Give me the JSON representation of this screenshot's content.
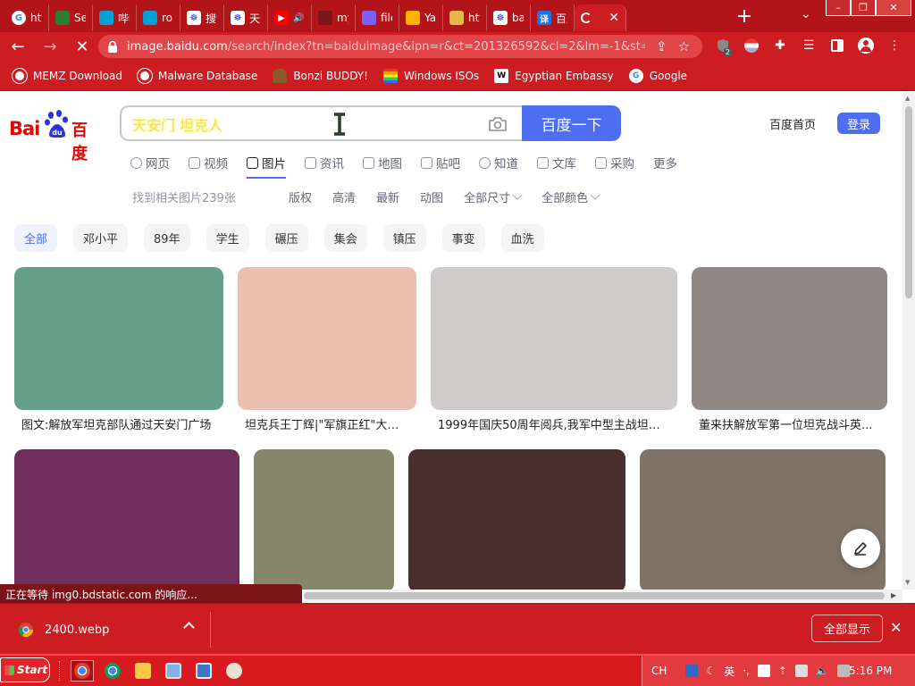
{
  "browser": {
    "tabs": [
      {
        "label": "http",
        "favicon": "google-icon",
        "color": "#4285f4"
      },
      {
        "label": "Sec",
        "favicon": "shield-icon",
        "color": "#2e7d32"
      },
      {
        "label": "哔哩",
        "favicon": "bilibili-icon",
        "color": "#00a1d6"
      },
      {
        "label": "rob",
        "favicon": "bilibili-icon",
        "color": "#00a1d6"
      },
      {
        "label": "搜索",
        "favicon": "baidu-paw-icon",
        "color": "#2932e1"
      },
      {
        "label": "天安",
        "favicon": "baidu-paw-icon",
        "color": "#2932e1"
      },
      {
        "label": "",
        "favicon": "youtube-icon",
        "color": "#ff0000"
      },
      {
        "label": "my",
        "favicon": "loading-icon",
        "color": "#7a1418"
      },
      {
        "label": "file",
        "favicon": "lightning-icon",
        "color": "#7b61ff"
      },
      {
        "label": "Yar",
        "favicon": "star-icon",
        "color": "#ffb300"
      },
      {
        "label": "http",
        "favicon": "bonzi-icon",
        "color": "#e6b84a"
      },
      {
        "label": "bai",
        "favicon": "baidu-paw-icon",
        "color": "#2932e1"
      },
      {
        "label": "百度",
        "favicon": "translate-icon",
        "color": "#1a73e8"
      }
    ],
    "active_tab": {
      "label": "",
      "close": "✕"
    },
    "new_tab": "+",
    "url_host": "image.baidu.com",
    "url_rest": "/search/index?tn=baiduimage&ipn=r&ct=201326592&cl=2&lm=-1&st=-...",
    "extension_badge": "2",
    "bookmarks": [
      {
        "label": "MEMZ Download",
        "icon": "globe-icon",
        "color": "#ffffff"
      },
      {
        "label": "Malware Database",
        "icon": "globe-icon",
        "color": "#ffffff"
      },
      {
        "label": "Bonzi BUDDY!",
        "icon": "bonzi-icon",
        "color": "#8b5a2b"
      },
      {
        "label": "Windows ISOs",
        "icon": "rainbow-flag-icon",
        "color": "#e040fb"
      },
      {
        "label": "Egyptian Embassy",
        "icon": "wix-icon",
        "color": "#ffffff"
      },
      {
        "label": "Google",
        "icon": "google-icon",
        "color": "#ffffff"
      }
    ]
  },
  "page": {
    "logo_latin": "Bai",
    "logo_cn": "百度",
    "search_value": "天安门 坦克人",
    "search_button": "百度一下",
    "home_link": "百度首页",
    "login": "登录",
    "nav_tabs": [
      {
        "label": "网页",
        "icon": "search-icon"
      },
      {
        "label": "视频",
        "icon": "video-icon"
      },
      {
        "label": "图片",
        "icon": "image-icon",
        "active": true
      },
      {
        "label": "资讯",
        "icon": "news-icon"
      },
      {
        "label": "地图",
        "icon": "map-pin-icon"
      },
      {
        "label": "贴吧",
        "icon": "tieba-icon"
      },
      {
        "label": "知道",
        "icon": "question-icon"
      },
      {
        "label": "文库",
        "icon": "document-icon"
      },
      {
        "label": "采购",
        "icon": "shopping-icon"
      },
      {
        "label": "更多",
        "icon": ""
      }
    ],
    "result_count": "找到相关图片239张",
    "filters": [
      "版权",
      "高清",
      "最新",
      "动图",
      "全部尺寸",
      "全部颜色"
    ],
    "chips": [
      "全部",
      "邓小平",
      "89年",
      "学生",
      "碾压",
      "集会",
      "镇压",
      "事变",
      "血洗"
    ],
    "images": [
      {
        "caption": "图文:解放军坦克部队通过天安门广场",
        "color": "#66a08a"
      },
      {
        "caption": "坦克兵王丁辉|\"军旗正红\"大型...",
        "color": "#ecc0b0"
      },
      {
        "caption": "1999年国庆50周年阅兵,我军中型主战坦克...",
        "color": "#cfcbcb"
      },
      {
        "caption": "董来扶解放军第一位坦克战斗英...",
        "color": "#918784"
      },
      {
        "caption": "",
        "color": "#702e5e"
      },
      {
        "caption": "",
        "color": "#86876a"
      },
      {
        "caption": "",
        "color": "#4a2f2e"
      },
      {
        "caption": "",
        "color": "#7f7267"
      }
    ],
    "status_text": "正在等待 img0.bdstatic.com 的响应..."
  },
  "downloads": {
    "file": "2400.webp",
    "show_all": "全部显示"
  },
  "taskbar": {
    "start": "Start",
    "lang": "CH",
    "ime": "英",
    "clock": "5:16 PM"
  }
}
